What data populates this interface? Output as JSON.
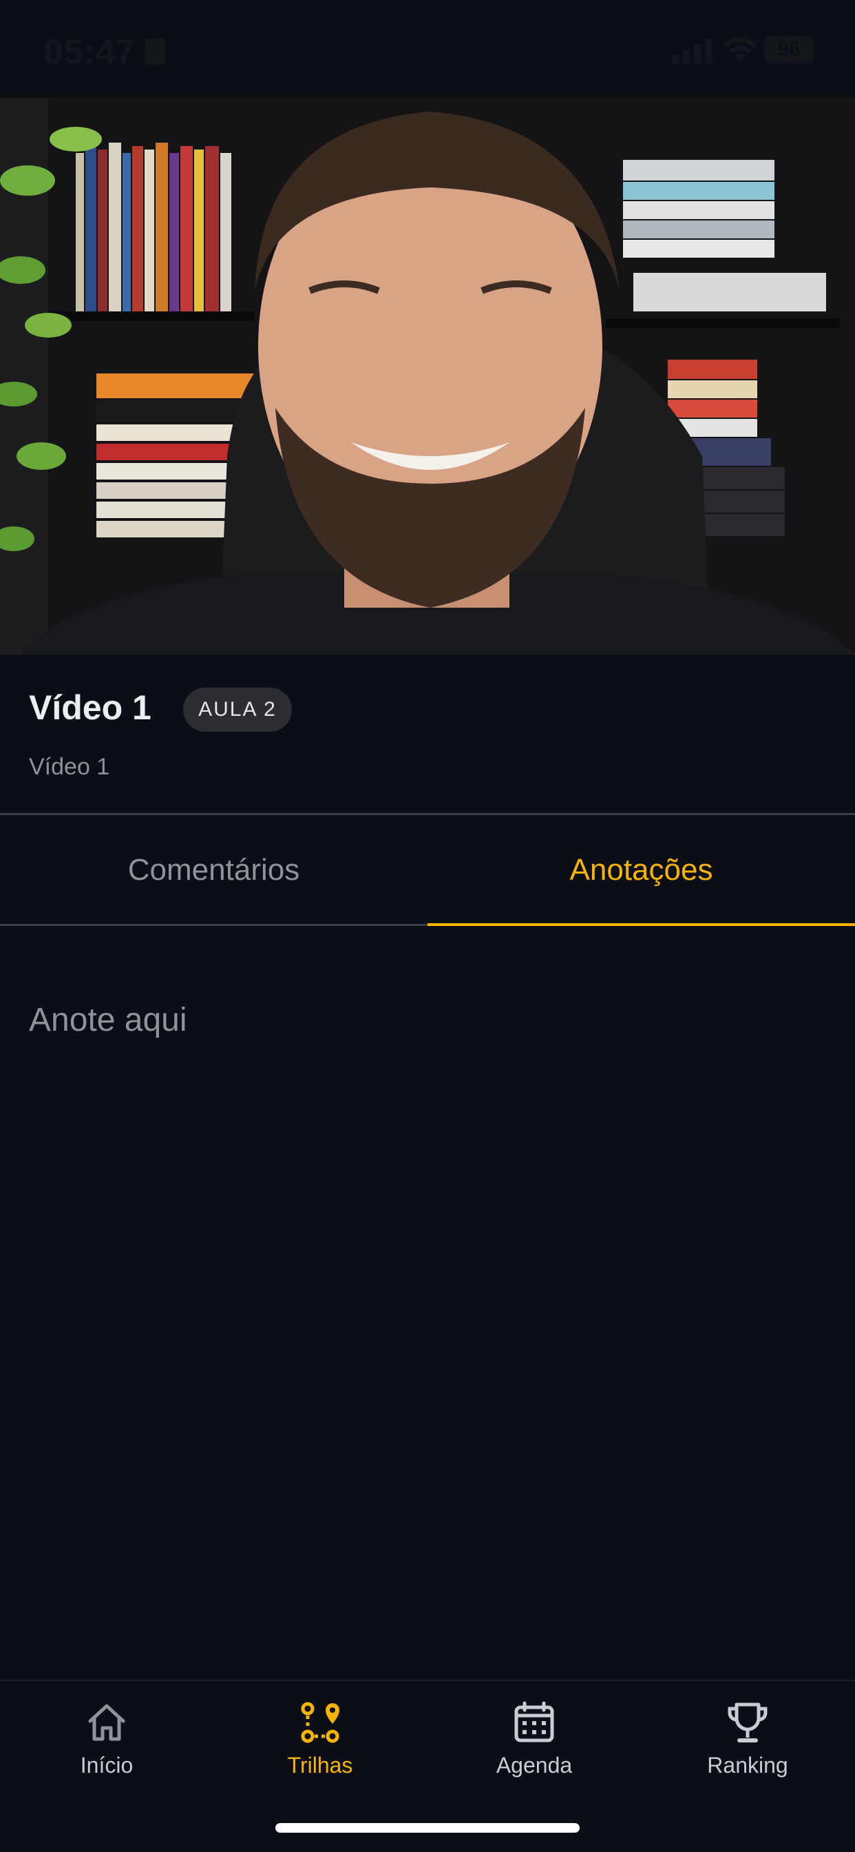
{
  "status_bar": {
    "time": "05:47",
    "battery": "96"
  },
  "video": {
    "icon": "video-player"
  },
  "lesson": {
    "title": "Vídeo 1",
    "badge": "AULA 2",
    "subtitle": "Vídeo 1"
  },
  "tabs": [
    {
      "label": "Comentários",
      "active": false
    },
    {
      "label": "Anotações",
      "active": true
    }
  ],
  "notes": {
    "placeholder": "Anote aqui",
    "value": ""
  },
  "bottom_nav": [
    {
      "label": "Início",
      "icon": "home-icon",
      "active": false
    },
    {
      "label": "Trilhas",
      "icon": "route-icon",
      "active": true
    },
    {
      "label": "Agenda",
      "icon": "calendar-icon",
      "active": false
    },
    {
      "label": "Ranking",
      "icon": "trophy-icon",
      "active": false
    }
  ],
  "colors": {
    "background": "#0b0e15",
    "accent": "#f6b400",
    "muted": "#8e929b",
    "badge_bg": "#2b2d33"
  }
}
